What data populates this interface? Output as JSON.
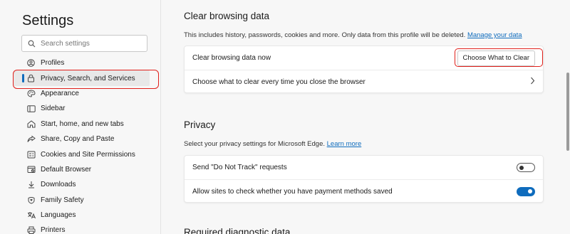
{
  "sidebar": {
    "title": "Settings",
    "search_placeholder": "Search settings",
    "items": [
      {
        "label": "Profiles",
        "icon": "profile-icon"
      },
      {
        "label": "Privacy, Search, and Services",
        "icon": "lock-icon"
      },
      {
        "label": "Appearance",
        "icon": "appearance-icon"
      },
      {
        "label": "Sidebar",
        "icon": "sidebar-icon"
      },
      {
        "label": "Start, home, and new tabs",
        "icon": "home-icon"
      },
      {
        "label": "Share, Copy and Paste",
        "icon": "share-icon"
      },
      {
        "label": "Cookies and Site Permissions",
        "icon": "cookies-icon"
      },
      {
        "label": "Default Browser",
        "icon": "browser-icon"
      },
      {
        "label": "Downloads",
        "icon": "download-icon"
      },
      {
        "label": "Family Safety",
        "icon": "family-icon"
      },
      {
        "label": "Languages",
        "icon": "languages-icon"
      },
      {
        "label": "Printers",
        "icon": "printer-icon"
      }
    ]
  },
  "clear_data": {
    "title": "Clear browsing data",
    "description": "This includes history, passwords, cookies and more. Only data from this profile will be deleted.",
    "link": "Manage your data",
    "row1_label": "Clear browsing data now",
    "row1_button": "Choose What to Clear",
    "row2_label": "Choose what to clear every time you close the browser"
  },
  "privacy": {
    "title": "Privacy",
    "description": "Select your privacy settings for Microsoft Edge.",
    "link": "Learn more",
    "row1_label": "Send \"Do Not Track\" requests",
    "row1_toggle": "off",
    "row2_label": "Allow sites to check whether you have payment methods saved",
    "row2_toggle": "on"
  },
  "diagnostic": {
    "title": "Required diagnostic data"
  },
  "colors": {
    "accent": "#0f6cbd",
    "highlight": "#e0201b"
  }
}
